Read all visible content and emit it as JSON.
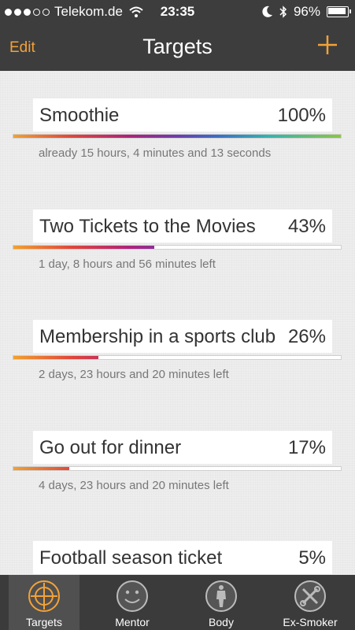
{
  "status_bar": {
    "carrier": "Telekom.de",
    "time": "23:35",
    "battery": "96%"
  },
  "nav": {
    "edit_label": "Edit",
    "title": "Targets"
  },
  "accent_color": "#f3a238",
  "targets": [
    {
      "name": "Smoothie",
      "percent_label": "100%",
      "progress": 1.0,
      "detail": "already 15 hours, 4 minutes and 13 seconds"
    },
    {
      "name": "Two Tickets to the Movies",
      "percent_label": "43%",
      "progress": 0.43,
      "detail": "1 day, 8 hours and 56 minutes left"
    },
    {
      "name": "Membership in a sports club",
      "percent_label": "26%",
      "progress": 0.26,
      "detail": "2 days, 23 hours and 20 minutes left"
    },
    {
      "name": "Go out for dinner",
      "percent_label": "17%",
      "progress": 0.17,
      "detail": "4 days, 23 hours and 20 minutes left"
    },
    {
      "name": "Football season ticket",
      "percent_label": "5%",
      "progress": 0.05,
      "detail": ""
    }
  ],
  "tabs": [
    {
      "label": "Targets",
      "icon": "crosshair-icon",
      "active": true
    },
    {
      "label": "Mentor",
      "icon": "smiley-icon",
      "active": false
    },
    {
      "label": "Body",
      "icon": "body-icon",
      "active": false
    },
    {
      "label": "Ex-Smoker",
      "icon": "tools-icon",
      "active": false
    }
  ]
}
